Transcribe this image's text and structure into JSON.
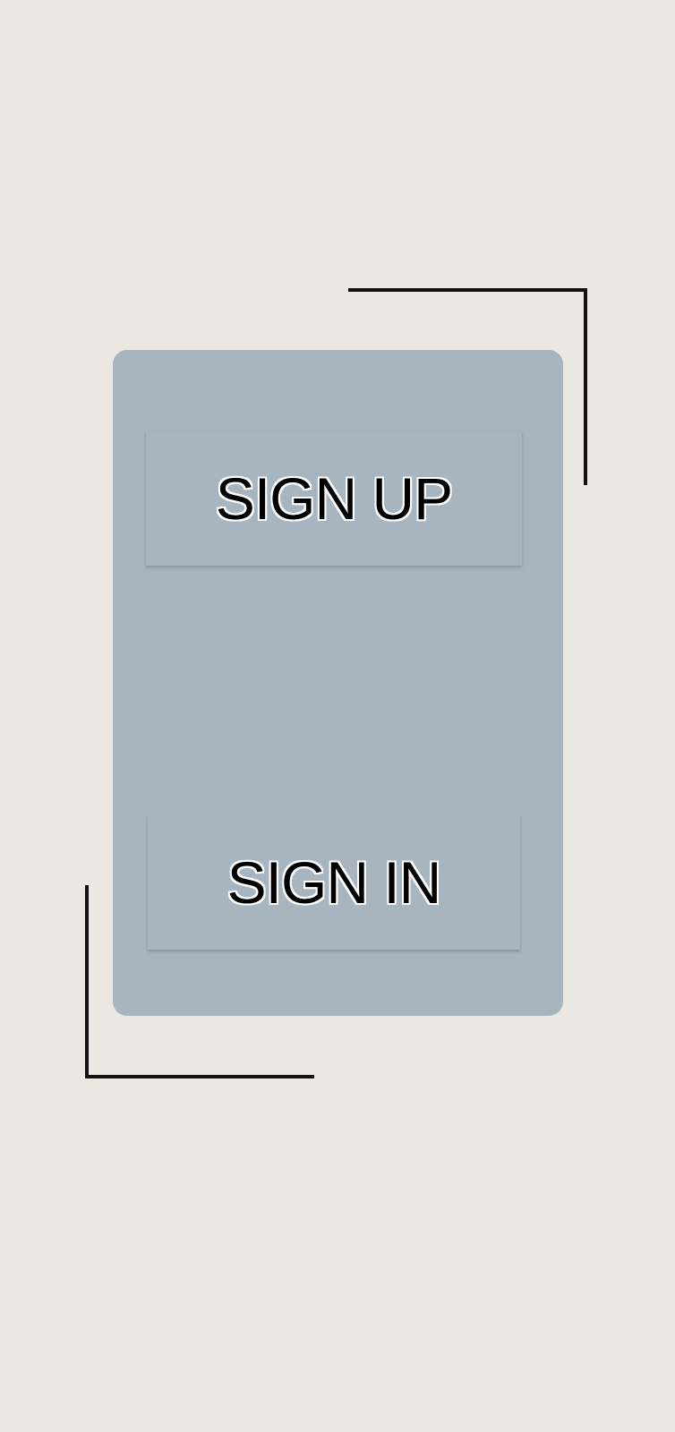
{
  "auth": {
    "signup_label": "SIGN UP",
    "signin_label": "SIGN IN"
  },
  "colors": {
    "background": "#eae8e1",
    "card": "#a6b5bf",
    "frame_lines": "#141010",
    "label_text": "#000000",
    "label_outline": "#ffffff"
  }
}
